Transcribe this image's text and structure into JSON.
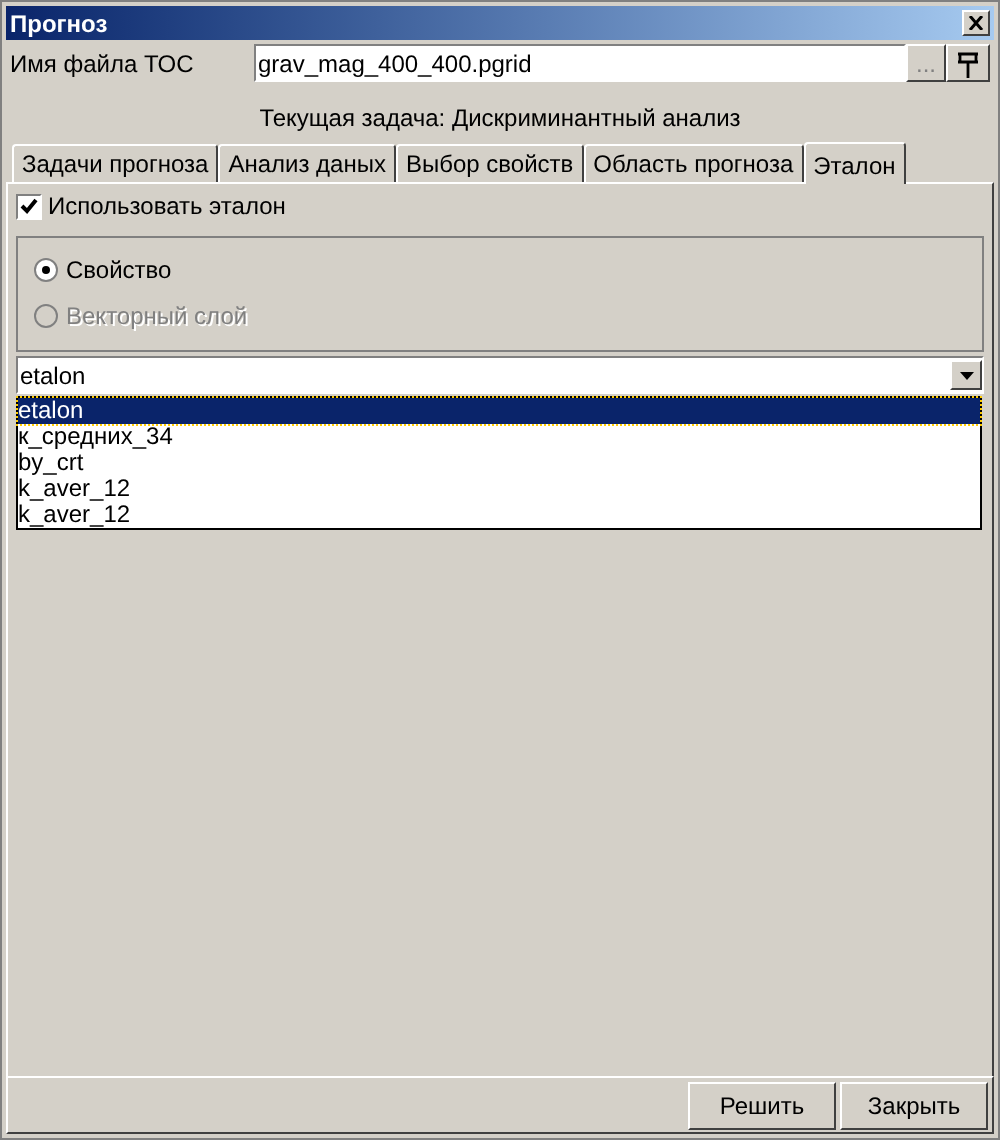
{
  "window": {
    "title": "Прогноз"
  },
  "file": {
    "label": "Имя файла ТОС",
    "value": "grav_mag_400_400.pgrid",
    "browse": "..."
  },
  "task": "Текущая задача: Дискриминантный анализ",
  "tabs": [
    {
      "label": "Задачи прогноза",
      "selected": false
    },
    {
      "label": "Анализ даных",
      "selected": false
    },
    {
      "label": "Выбор свойств",
      "selected": false
    },
    {
      "label": "Область прогноза",
      "selected": false
    },
    {
      "label": "Эталон",
      "selected": true
    }
  ],
  "use_etalon": {
    "label": "Использовать эталон",
    "checked": true
  },
  "radios": [
    {
      "label": "Свойство",
      "selected": true,
      "disabled": false
    },
    {
      "label": "Векторный слой",
      "selected": false,
      "disabled": true
    }
  ],
  "combo": {
    "value": "etalon",
    "options": [
      {
        "label": "etalon",
        "selected": true
      },
      {
        "label": "к_средних_34",
        "selected": false
      },
      {
        "label": "by_crt",
        "selected": false
      },
      {
        "label": "k_aver_12",
        "selected": false
      },
      {
        "label": "k_aver_12",
        "selected": false
      }
    ]
  },
  "buttons": [
    "Решить",
    "Закрыть"
  ]
}
